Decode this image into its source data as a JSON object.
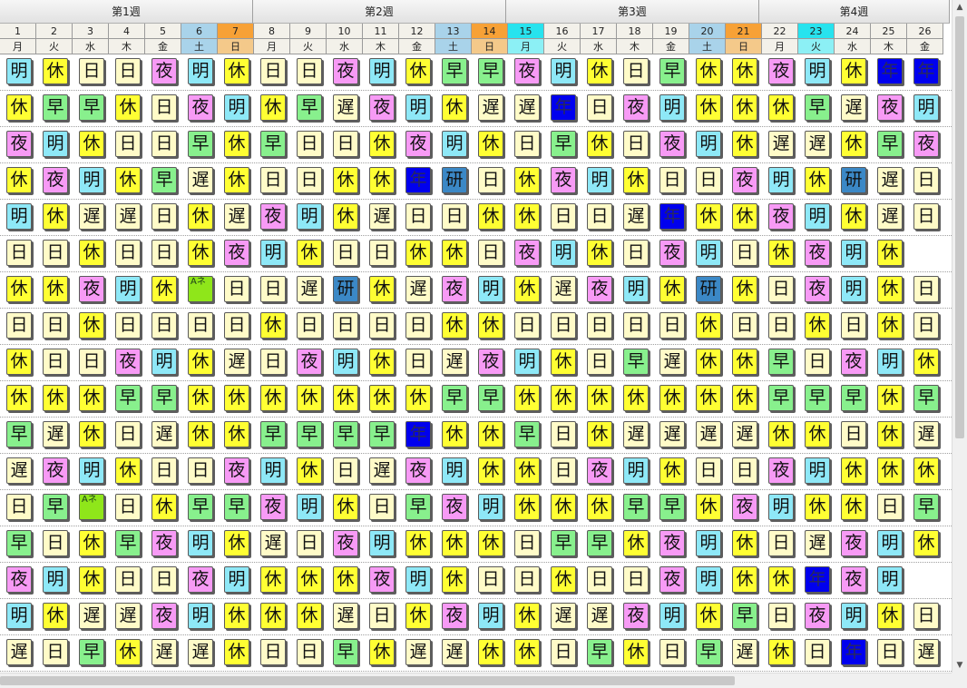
{
  "weeks": [
    "第1週",
    "第2週",
    "第3週",
    "第4週"
  ],
  "days": [
    {
      "d": "1",
      "w": "月",
      "t": "normal"
    },
    {
      "d": "2",
      "w": "火",
      "t": "normal"
    },
    {
      "d": "3",
      "w": "水",
      "t": "normal"
    },
    {
      "d": "4",
      "w": "木",
      "t": "normal"
    },
    {
      "d": "5",
      "w": "金",
      "t": "normal"
    },
    {
      "d": "6",
      "w": "土",
      "t": "sat"
    },
    {
      "d": "7",
      "w": "日",
      "t": "sun"
    },
    {
      "d": "8",
      "w": "月",
      "t": "normal"
    },
    {
      "d": "9",
      "w": "火",
      "t": "normal"
    },
    {
      "d": "10",
      "w": "水",
      "t": "normal"
    },
    {
      "d": "11",
      "w": "木",
      "t": "normal"
    },
    {
      "d": "12",
      "w": "金",
      "t": "normal"
    },
    {
      "d": "13",
      "w": "土",
      "t": "sat"
    },
    {
      "d": "14",
      "w": "日",
      "t": "sun"
    },
    {
      "d": "15",
      "w": "月",
      "t": "hol"
    },
    {
      "d": "16",
      "w": "火",
      "t": "normal"
    },
    {
      "d": "17",
      "w": "水",
      "t": "normal"
    },
    {
      "d": "18",
      "w": "木",
      "t": "normal"
    },
    {
      "d": "19",
      "w": "金",
      "t": "normal"
    },
    {
      "d": "20",
      "w": "土",
      "t": "sat"
    },
    {
      "d": "21",
      "w": "日",
      "t": "sun"
    },
    {
      "d": "22",
      "w": "月",
      "t": "normal"
    },
    {
      "d": "23",
      "w": "火",
      "t": "hol"
    },
    {
      "d": "24",
      "w": "水",
      "t": "normal"
    },
    {
      "d": "25",
      "w": "木",
      "t": "normal"
    },
    {
      "d": "26",
      "w": "金",
      "t": "normal"
    }
  ],
  "shift_types": {
    "休": "rest",
    "明": "akegi",
    "日": "day",
    "夜": "night",
    "早": "early",
    "遅": "late",
    "年": "annual",
    "研": "study",
    "Aネ": "ane"
  },
  "schedule": [
    [
      "明",
      "休",
      "日",
      "日",
      "夜",
      "明",
      "休",
      "日",
      "日",
      "夜",
      "明",
      "休",
      "早",
      "早",
      "夜",
      "明",
      "休",
      "日",
      "早",
      "休",
      "休",
      "夜",
      "明",
      "休",
      "年",
      "年"
    ],
    [
      "休",
      "早",
      "早",
      "休",
      "日",
      "夜",
      "明",
      "休",
      "早",
      "遅",
      "夜",
      "明",
      "休",
      "遅",
      "遅",
      "年",
      "日",
      "夜",
      "明",
      "休",
      "休",
      "休",
      "早",
      "遅",
      "夜",
      "明"
    ],
    [
      "夜",
      "明",
      "休",
      "日",
      "日",
      "早",
      "休",
      "早",
      "日",
      "日",
      "休",
      "夜",
      "明",
      "休",
      "日",
      "早",
      "休",
      "日",
      "夜",
      "明",
      "休",
      "遅",
      "遅",
      "休",
      "早",
      "夜"
    ],
    [
      "休",
      "夜",
      "明",
      "休",
      "早",
      "遅",
      "休",
      "日",
      "日",
      "休",
      "休",
      "年",
      "研",
      "日",
      "休",
      "夜",
      "明",
      "休",
      "日",
      "日",
      "夜",
      "明",
      "休",
      "研",
      "遅",
      "日"
    ],
    [
      "明",
      "休",
      "遅",
      "遅",
      "日",
      "休",
      "遅",
      "夜",
      "明",
      "休",
      "遅",
      "日",
      "日",
      "休",
      "休",
      "日",
      "日",
      "遅",
      "年",
      "休",
      "休",
      "夜",
      "明",
      "休",
      "遅",
      "日"
    ],
    [
      "日",
      "日",
      "休",
      "日",
      "日",
      "休",
      "夜",
      "明",
      "休",
      "日",
      "日",
      "休",
      "休",
      "日",
      "夜",
      "明",
      "休",
      "日",
      "夜",
      "明",
      "日",
      "休",
      "夜",
      "明",
      "休"
    ],
    [
      "休",
      "休",
      "夜",
      "明",
      "休",
      "Aネ",
      "日",
      "日",
      "遅",
      "研",
      "休",
      "遅",
      "夜",
      "明",
      "休",
      "遅",
      "夜",
      "明",
      "休",
      "研",
      "休",
      "日",
      "夜",
      "明",
      "休",
      "日"
    ],
    [
      "日",
      "日",
      "休",
      "日",
      "日",
      "日",
      "日",
      "休",
      "日",
      "日",
      "日",
      "日",
      "休",
      "休",
      "日",
      "日",
      "日",
      "日",
      "日",
      "休",
      "日",
      "日",
      "休",
      "日",
      "休",
      "日"
    ],
    [
      "休",
      "日",
      "日",
      "夜",
      "明",
      "休",
      "遅",
      "日",
      "夜",
      "明",
      "休",
      "日",
      "遅",
      "夜",
      "明",
      "休",
      "日",
      "早",
      "遅",
      "休",
      "休",
      "早",
      "日",
      "夜",
      "明",
      "休"
    ],
    [
      "休",
      "休",
      "休",
      "早",
      "早",
      "休",
      "休",
      "休",
      "休",
      "休",
      "休",
      "休",
      "早",
      "早",
      "休",
      "休",
      "休",
      "休",
      "休",
      "休",
      "休",
      "早",
      "早",
      "早",
      "休",
      "早"
    ],
    [
      "早",
      "遅",
      "休",
      "日",
      "遅",
      "休",
      "休",
      "早",
      "早",
      "早",
      "早",
      "年",
      "休",
      "休",
      "早",
      "日",
      "休",
      "遅",
      "遅",
      "遅",
      "遅",
      "休",
      "休",
      "日",
      "休",
      "遅"
    ],
    [
      "遅",
      "夜",
      "明",
      "休",
      "日",
      "日",
      "夜",
      "明",
      "休",
      "日",
      "遅",
      "夜",
      "明",
      "休",
      "休",
      "日",
      "夜",
      "明",
      "休",
      "日",
      "日",
      "夜",
      "明",
      "休",
      "休",
      "休"
    ],
    [
      "日",
      "早",
      "Aネ",
      "日",
      "休",
      "早",
      "早",
      "夜",
      "明",
      "休",
      "日",
      "早",
      "夜",
      "明",
      "休",
      "休",
      "休",
      "早",
      "早",
      "休",
      "夜",
      "明",
      "休",
      "休",
      "日",
      "早"
    ],
    [
      "早",
      "日",
      "休",
      "早",
      "夜",
      "明",
      "休",
      "遅",
      "日",
      "夜",
      "明",
      "休",
      "休",
      "休",
      "日",
      "早",
      "早",
      "休",
      "夜",
      "明",
      "休",
      "日",
      "遅",
      "夜",
      "明",
      "休"
    ],
    [
      "夜",
      "明",
      "休",
      "日",
      "日",
      "夜",
      "明",
      "休",
      "休",
      "休",
      "夜",
      "明",
      "休",
      "日",
      "日",
      "休",
      "日",
      "日",
      "夜",
      "明",
      "休",
      "休",
      "年",
      "夜",
      "明"
    ],
    [
      "明",
      "休",
      "遅",
      "遅",
      "夜",
      "明",
      "休",
      "休",
      "休",
      "遅",
      "日",
      "休",
      "夜",
      "明",
      "休",
      "遅",
      "遅",
      "夜",
      "明",
      "休",
      "早",
      "日",
      "夜",
      "明",
      "休",
      "日"
    ],
    [
      "遅",
      "日",
      "早",
      "休",
      "遅",
      "遅",
      "休",
      "日",
      "日",
      "早",
      "休",
      "遅",
      "遅",
      "休",
      "休",
      "日",
      "早",
      "休",
      "日",
      "早",
      "遅",
      "休",
      "日",
      "年",
      "日",
      "遅"
    ]
  ]
}
